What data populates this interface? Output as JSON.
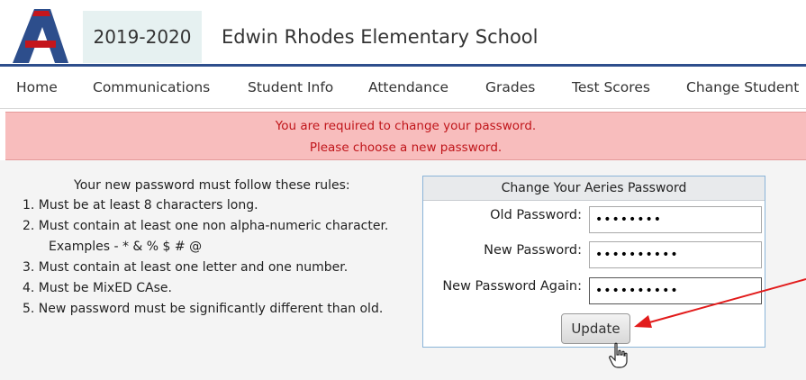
{
  "header": {
    "year": "2019-2020",
    "school_name": "Edwin Rhodes Elementary School",
    "logo_icon": "aeries-a-logo-icon"
  },
  "nav": {
    "items": [
      {
        "label": "Home"
      },
      {
        "label": "Communications"
      },
      {
        "label": "Student Info"
      },
      {
        "label": "Attendance"
      },
      {
        "label": "Grades"
      },
      {
        "label": "Test Scores"
      },
      {
        "label": "Change Student"
      }
    ]
  },
  "alert": {
    "line1": "You are required to change your password.",
    "line2": "Please choose a new password.",
    "color": "#c0151a"
  },
  "rules": {
    "heading": "Your new password must follow these rules:",
    "items": [
      "1. Must be at least 8 characters long.",
      "2. Must contain at least one non alpha-numeric character.",
      "Examples - * & % $ # @",
      "3. Must contain at least one letter and one number.",
      "4. Must be MixED CAse.",
      "5. New password must be significantly different than old."
    ]
  },
  "password_form": {
    "title": "Change Your Aeries Password",
    "old_label": "Old Password:",
    "old_value": "••••••••",
    "new_label": "New Password:",
    "new_value": "••••••••••",
    "again_label": "New Password Again:",
    "again_value": "••••••••••",
    "update_label": "Update"
  },
  "colors": {
    "brand_blue": "#2d4e8c",
    "brand_red": "#c4161c",
    "alert_bg": "#f8bdbd",
    "annotation_arrow": "#e21b1b"
  }
}
